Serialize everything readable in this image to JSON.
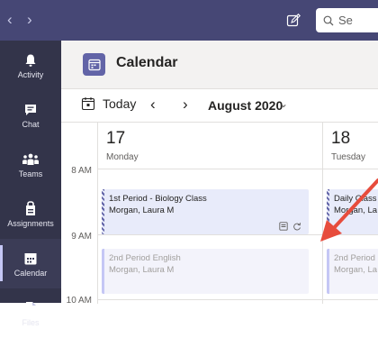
{
  "titlebar": {
    "back_icon": "chevron-left",
    "forward_icon": "chevron-right",
    "search_placeholder": "Se"
  },
  "rail": {
    "items": [
      {
        "label": "Activity",
        "icon": "bell-icon"
      },
      {
        "label": "Chat",
        "icon": "chat-icon"
      },
      {
        "label": "Teams",
        "icon": "teams-icon"
      },
      {
        "label": "Assignments",
        "icon": "assignments-icon"
      },
      {
        "label": "Calendar",
        "icon": "calendar-icon",
        "active": true
      },
      {
        "label": "Files",
        "icon": "file-icon"
      }
    ]
  },
  "header": {
    "title": "Calendar"
  },
  "toolbar": {
    "today_label": "Today",
    "month_label": "August 2020"
  },
  "time_labels": [
    "8 AM",
    "9 AM",
    "10 AM"
  ],
  "days": [
    {
      "number": "17",
      "name": "Monday"
    },
    {
      "number": "18",
      "name": "Tuesday"
    }
  ],
  "events": {
    "monday": [
      {
        "title": "1st Period - Biology Class",
        "organizer": "Morgan, Laura M"
      },
      {
        "title": "2nd Period English",
        "organizer": "Morgan, Laura M"
      }
    ],
    "tuesday": [
      {
        "title": "Daily Class",
        "organizer": "Morgan, La"
      },
      {
        "title": "2nd Period",
        "organizer": "Morgan, La"
      }
    ]
  },
  "colors": {
    "titlebar": "#464775",
    "rail": "#33344a",
    "accent": "#6264a7",
    "arrow": "#e74c3c"
  }
}
